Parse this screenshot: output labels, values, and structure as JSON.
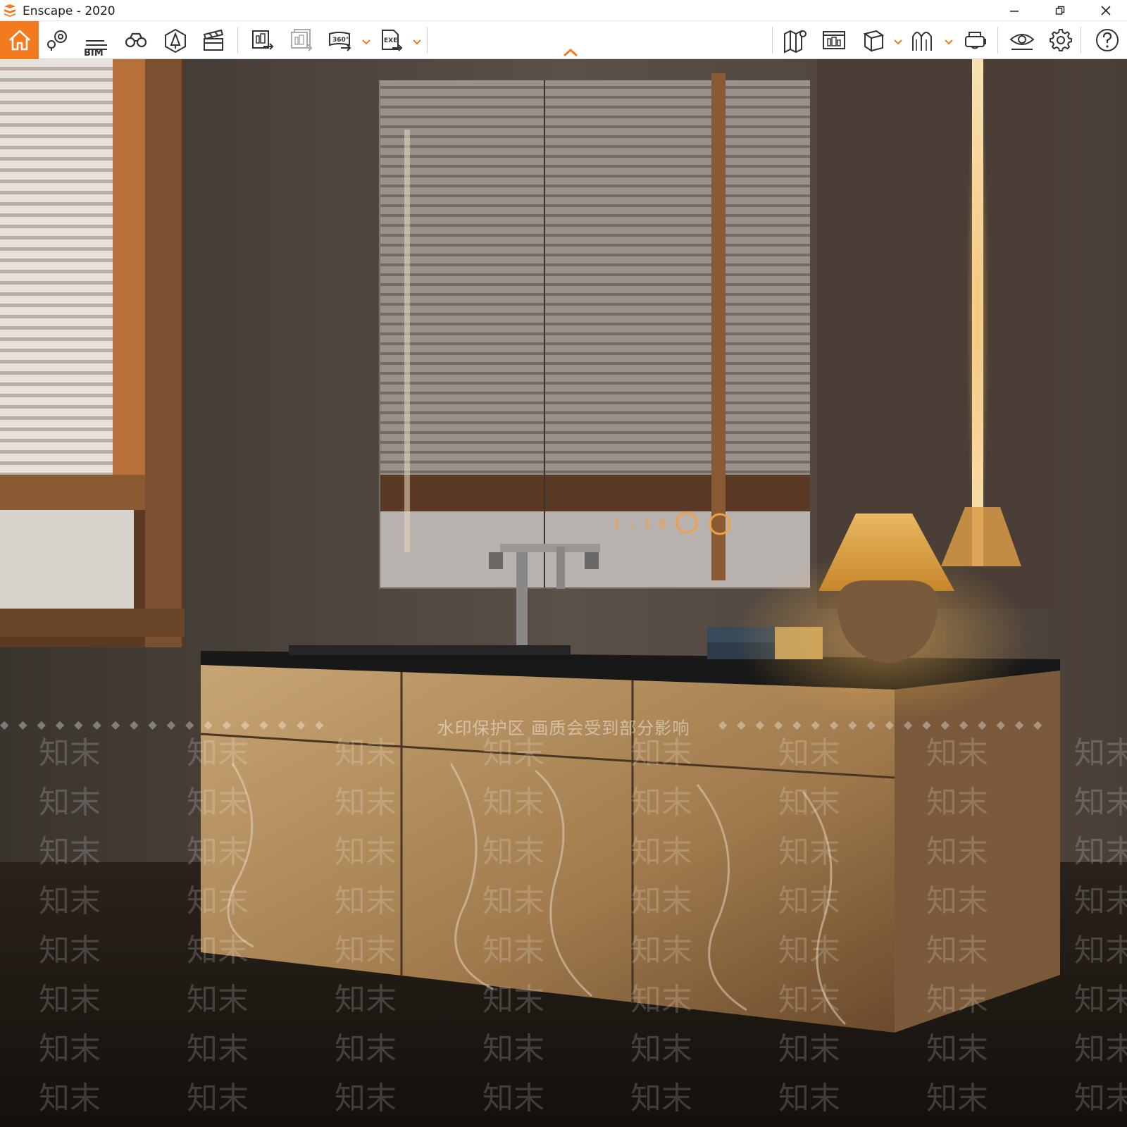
{
  "window": {
    "title": "Enscape - 2020",
    "controls": {
      "minimize": "minimize",
      "restore": "restore",
      "close": "close"
    }
  },
  "toolbar": {
    "bim_label": "BIM",
    "items": [
      "home-icon",
      "view-management-icon",
      "bim-info-icon",
      "walk-mode-icon",
      "asset-library-icon",
      "video-editor-icon",
      "screenshot-export-icon",
      "batch-render-icon",
      "panorama-360-icon",
      "standalone-exe-icon",
      "map-icon",
      "web-standalone-icon",
      "collaboration-icon",
      "vr-mode-icon",
      "headset-icon",
      "visual-settings-icon",
      "settings-icon",
      "help-icon"
    ],
    "panorama_label": "360°",
    "exe_label": "EXE",
    "accent_color": "#f47a20"
  },
  "viewport": {
    "watermark_char": "知末",
    "watermark_banner": "水印保护区   画质会受到部分影响"
  }
}
